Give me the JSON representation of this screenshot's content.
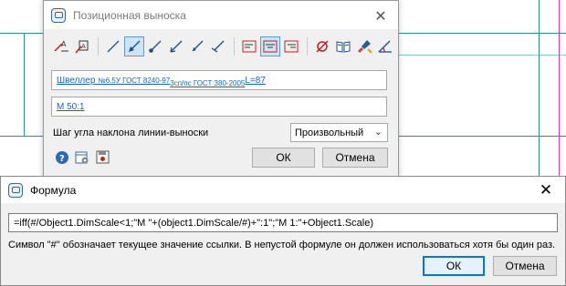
{
  "background": {
    "accent_teal": "#2f8f8f",
    "accent_magenta": "#c040c0"
  },
  "position_dialog": {
    "title": "Позиционная выноска",
    "icon": "app-dialog-icon",
    "close_glyph": "✕",
    "toolbar_icons": [
      "leader-text-left-icon",
      "leader-text-right-icon",
      "line-plain-icon",
      "line-arrow-active-icon",
      "line-dot-icon",
      "line-arrow-icon",
      "line-arrow-small-icon",
      "line-tick-icon",
      "align-left-icon",
      "align-center-icon",
      "align-right-icon",
      "diameter-icon",
      "book-icon",
      "brush-icon",
      "angle-icon"
    ],
    "designation": {
      "main": "Швеллер",
      "sup": "№6.5У ГОСТ 8240-97",
      "sub": "3сп/пс ГОСТ 380-2005",
      "tail": "L=87"
    },
    "scale_field": "М 50:1",
    "angle_label": "Шаг угла наклона линии-выноски",
    "angle_value": "Произвольный",
    "ok_label": "ОК",
    "cancel_label": "Отмена",
    "bottom_icons": [
      "help-icon",
      "settings-icon",
      "save-icon"
    ]
  },
  "formula_dialog": {
    "title": "Формула",
    "close_glyph": "✕",
    "formula_value": "=iff(#/Object1.DimScale<1;\"М \"+(object1.DimScale/#)+\":1\";\"М 1:\"+Object1.Scale)",
    "hint": "Символ \"#\" обозначает текущее значение ссылки. В непустой формуле он должен использоваться хотя бы один раз.",
    "ok_label": "ОК",
    "cancel_label": "Отмена"
  }
}
